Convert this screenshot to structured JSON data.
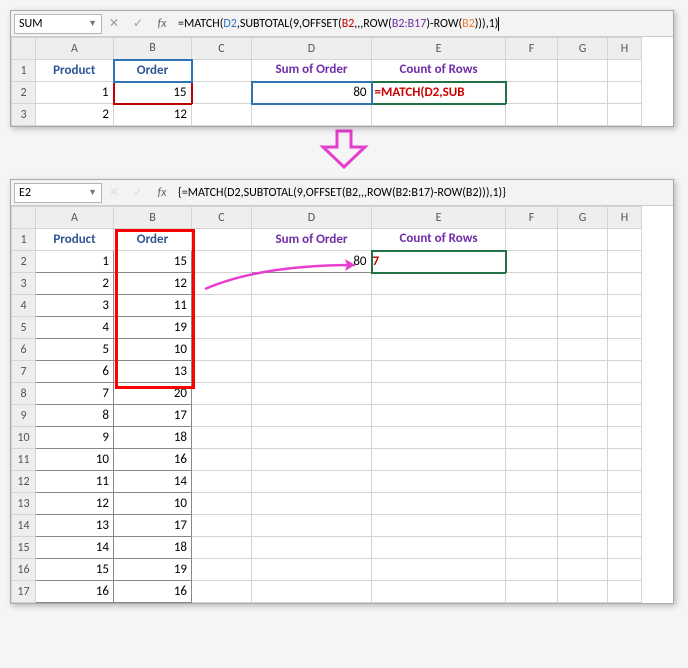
{
  "top": {
    "namebox": "SUM",
    "formula_text": "=MATCH(D2,SUBTOTAL(9,OFFSET(B2,,,ROW(B2:B17)-ROW(B2))),1)",
    "headers": {
      "A": "Product",
      "B": "Order",
      "D": "Sum of Order",
      "E": "Count of Rows"
    },
    "cells": {
      "A2": "1",
      "B2": "15",
      "D2": "80",
      "E2_overflow": "=MATCH(D2,SUB",
      "A3": "2",
      "B3": "12"
    },
    "cols": [
      "A",
      "B",
      "C",
      "D",
      "E",
      "F",
      "G",
      "H"
    ],
    "rows": [
      "1",
      "2",
      "3"
    ]
  },
  "bottom": {
    "namebox": "E2",
    "formula_text": "{=MATCH(D2,SUBTOTAL(9,OFFSET(B2,,,ROW(B2:B17)-ROW(B2))),1)}",
    "headers": {
      "A": "Product",
      "B": "Order",
      "D": "Sum of Order",
      "E": "Count of Rows"
    },
    "D2": "80",
    "E2": "7",
    "cols": [
      "A",
      "B",
      "C",
      "D",
      "E",
      "F",
      "G",
      "H"
    ],
    "rows": [
      "1",
      "2",
      "3",
      "4",
      "5",
      "6",
      "7",
      "8",
      "9",
      "10",
      "11",
      "12",
      "13",
      "14",
      "15",
      "16",
      "17"
    ],
    "data": [
      {
        "p": "1",
        "o": "15"
      },
      {
        "p": "2",
        "o": "12"
      },
      {
        "p": "3",
        "o": "11"
      },
      {
        "p": "4",
        "o": "19"
      },
      {
        "p": "5",
        "o": "10"
      },
      {
        "p": "6",
        "o": "13"
      },
      {
        "p": "7",
        "o": "20"
      },
      {
        "p": "8",
        "o": "17"
      },
      {
        "p": "9",
        "o": "18"
      },
      {
        "p": "10",
        "o": "16"
      },
      {
        "p": "11",
        "o": "14"
      },
      {
        "p": "12",
        "o": "10"
      },
      {
        "p": "13",
        "o": "17"
      },
      {
        "p": "14",
        "o": "18"
      },
      {
        "p": "15",
        "o": "19"
      },
      {
        "p": "16",
        "o": "16"
      }
    ]
  }
}
